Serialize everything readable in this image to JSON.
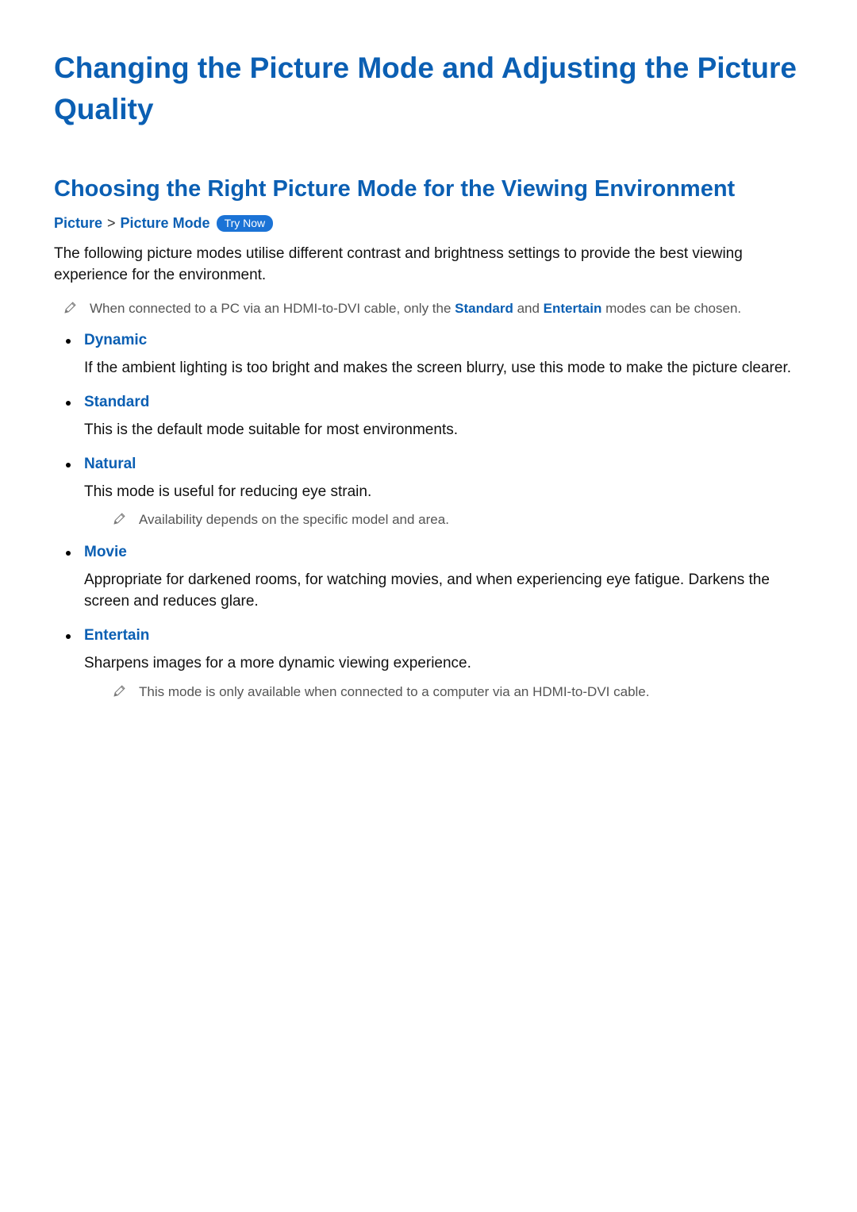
{
  "title": "Changing the Picture Mode and Adjusting the Picture Quality",
  "section_title": "Choosing the Right Picture Mode for the Viewing Environment",
  "breadcrumb": {
    "root": "Picture",
    "leaf": "Picture Mode",
    "try_now": "Try Now"
  },
  "intro": "The following picture modes utilise different contrast and brightness settings to provide the best viewing experience for the environment.",
  "top_note": {
    "prefix": "When connected to a PC via an HDMI-to-DVI cable, only the ",
    "term1": "Standard",
    "mid": " and ",
    "term2": "Entertain",
    "suffix": " modes can be chosen."
  },
  "modes": {
    "dynamic": {
      "name": "Dynamic",
      "desc": "If the ambient lighting is too bright and makes the screen blurry, use this mode to make the picture clearer."
    },
    "standard": {
      "name": "Standard",
      "desc": "This is the default mode suitable for most environments."
    },
    "natural": {
      "name": "Natural",
      "desc": "This mode is useful for reducing eye strain.",
      "note": "Availability depends on the specific model and area."
    },
    "movie": {
      "name": "Movie",
      "desc": "Appropriate for darkened rooms, for watching movies, and when experiencing eye fatigue. Darkens the screen and reduces glare."
    },
    "entertain": {
      "name": "Entertain",
      "desc": "Sharpens images for a more dynamic viewing experience.",
      "note": "This mode is only available when connected to a computer via an HDMI-to-DVI cable."
    }
  }
}
